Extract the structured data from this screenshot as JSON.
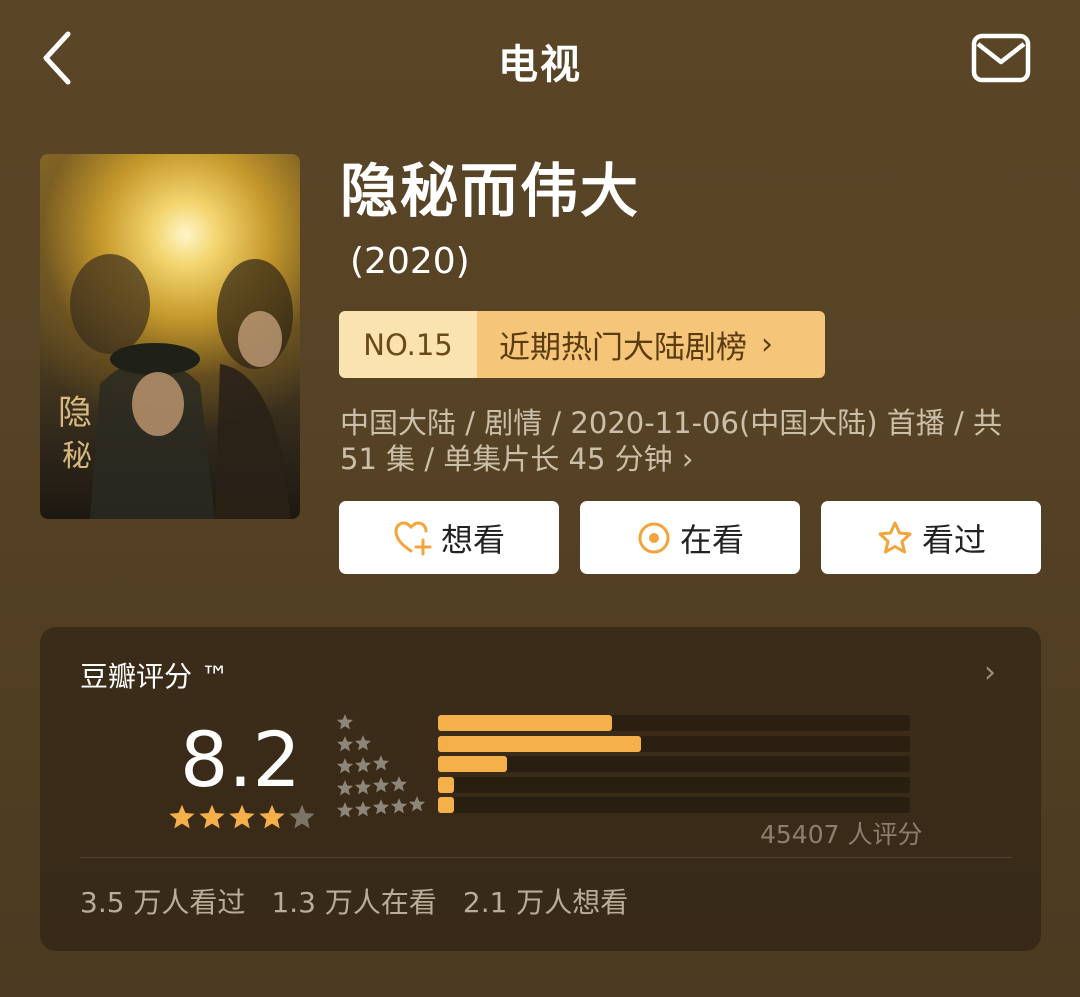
{
  "header": {
    "title": "电视",
    "back_icon": "back-chevron-icon",
    "mail_icon": "mail-icon"
  },
  "show": {
    "title": "隐秘而伟大",
    "year": "(2020)",
    "rank_no": "NO.15",
    "rank_label": "近期热门大陆剧榜",
    "meta": "中国大陆 / 剧情 / 2020-11-06(中国大陆) 首播 / 共 51 集 / 单集片长 45 分钟",
    "meta_chevron": "›"
  },
  "actions": [
    {
      "label": "想看",
      "icon": "heart-plus-icon"
    },
    {
      "label": "在看",
      "icon": "target-icon"
    },
    {
      "label": "看过",
      "icon": "star-outline-icon"
    }
  ],
  "rating": {
    "title": "豆瓣评分 ™",
    "score": "8.2",
    "stars_filled": 4,
    "stars_total": 5,
    "distribution": [
      {
        "stars": 5,
        "fraction": 0.368
      },
      {
        "stars": 4,
        "fraction": 0.43
      },
      {
        "stars": 3,
        "fraction": 0.146
      },
      {
        "stars": 2,
        "fraction": 0.03
      },
      {
        "stars": 1,
        "fraction": 0.03
      }
    ],
    "count_text": "45407 人评分",
    "stats": [
      "3.5 万人看过",
      "1.3 万人在看",
      "2.1 万人想看"
    ]
  },
  "colors": {
    "accent": "#f6b04a",
    "badge_left": "#fbe3b1",
    "badge_right": "#f5c57a"
  }
}
